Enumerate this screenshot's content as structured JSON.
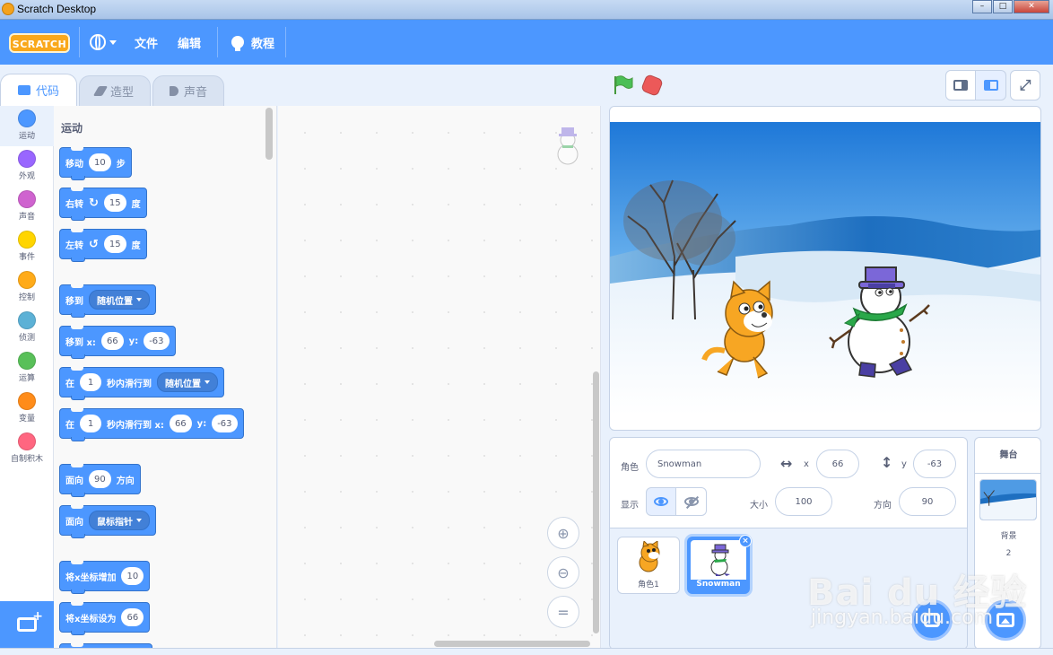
{
  "window": {
    "title": "Scratch Desktop"
  },
  "menubar": {
    "logo_text": "SCRATCH",
    "file": "文件",
    "edit": "编辑",
    "tutorials": "教程"
  },
  "tabs": [
    {
      "label": "代码",
      "icon": "code-icon",
      "active": true
    },
    {
      "label": "造型",
      "icon": "brush-icon",
      "active": false
    },
    {
      "label": "声音",
      "icon": "speaker-icon",
      "active": false
    }
  ],
  "categories": [
    {
      "label": "运动",
      "color": "#4c97ff"
    },
    {
      "label": "外观",
      "color": "#9966ff"
    },
    {
      "label": "声音",
      "color": "#cf63cf"
    },
    {
      "label": "事件",
      "color": "#ffd500"
    },
    {
      "label": "控制",
      "color": "#ffab19"
    },
    {
      "label": "侦测",
      "color": "#5cb1d6"
    },
    {
      "label": "运算",
      "color": "#59c059"
    },
    {
      "label": "变量",
      "color": "#ff8c1a"
    },
    {
      "label": "自制积木",
      "color": "#ff6680"
    }
  ],
  "palette": {
    "title": "运动",
    "blocks": {
      "move": {
        "a": "移动",
        "v": "10",
        "b": "步"
      },
      "turn_right": {
        "a": "右转",
        "v": "15",
        "b": "度"
      },
      "turn_left": {
        "a": "左转",
        "v": "15",
        "b": "度"
      },
      "goto": {
        "a": "移到",
        "dd": "随机位置"
      },
      "goto_xy": {
        "a": "移到 x:",
        "x": "66",
        "b": "y:",
        "y": "-63"
      },
      "glide_to": {
        "a": "在",
        "v": "1",
        "b": "秒内滑行到",
        "dd": "随机位置"
      },
      "glide_xy": {
        "a": "在",
        "v": "1",
        "b": "秒内滑行到 x:",
        "x": "66",
        "c": "y:",
        "y": "-63"
      },
      "point_dir": {
        "a": "面向",
        "v": "90",
        "b": "方向"
      },
      "point_towards": {
        "a": "面向",
        "dd": "鼠标指针"
      },
      "change_x": {
        "a": "将x坐标增加",
        "v": "10"
      },
      "set_x": {
        "a": "将x坐标设为",
        "v": "66"
      }
    }
  },
  "sprite_info": {
    "sprite_label": "角色",
    "sprite_name": "Snowman",
    "x_label": "x",
    "x": "66",
    "y_label": "y",
    "y": "-63",
    "show_label": "显示",
    "size_label": "大小",
    "size": "100",
    "direction_label": "方向",
    "direction": "90"
  },
  "sprites": [
    {
      "name": "角色1",
      "selected": false
    },
    {
      "name": "Snowman",
      "selected": true
    }
  ],
  "stage_panel": {
    "title": "舞台",
    "backdrops_label": "背景",
    "backdrops_count": "2"
  },
  "watermark": {
    "main": "Bai du 经验",
    "sub": "jingyan.baidu.com"
  },
  "colors": {
    "accent": "#4c97ff",
    "menubar": "#4c97ff",
    "stop": "#ec5959",
    "flag": "#4cbf56"
  }
}
